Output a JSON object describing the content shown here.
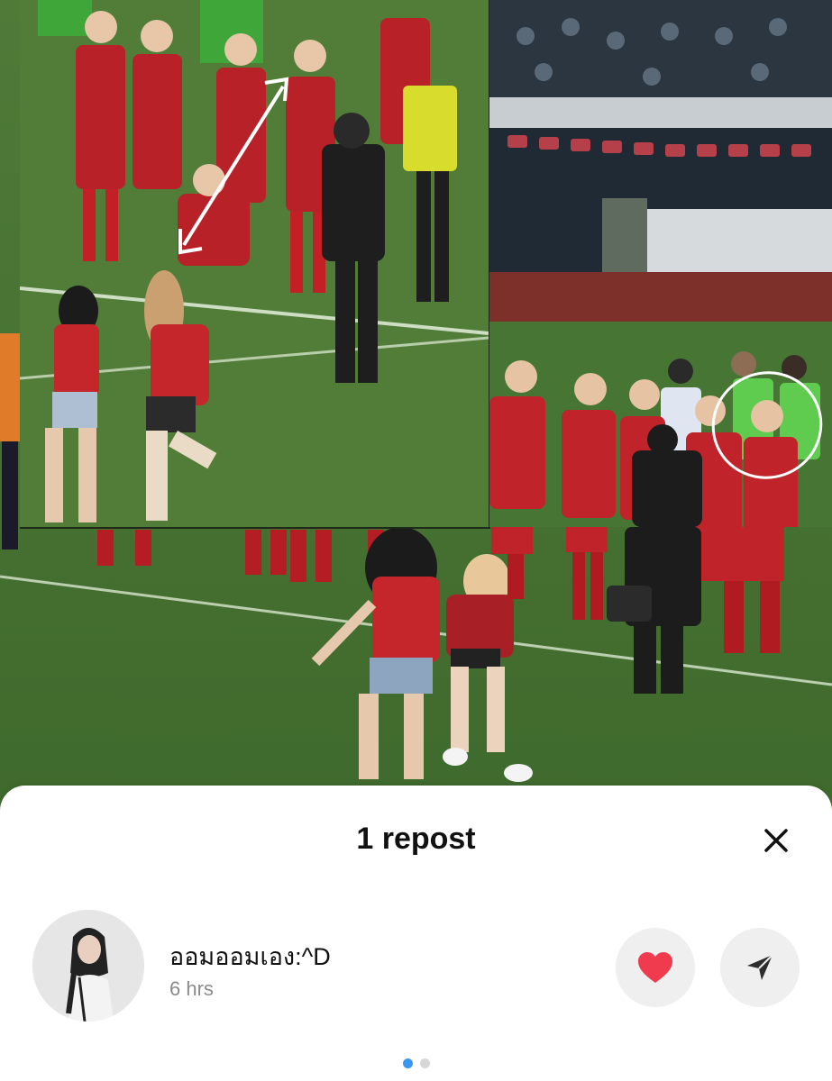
{
  "colors": {
    "accent": "#3897f0",
    "like_heart": "#ef3b4d",
    "button_bg": "#efefef"
  },
  "sheet": {
    "title": "1 repost",
    "close_icon": "close-icon",
    "repost": {
      "username": "ออมออมเอง:^D",
      "time": "6 hrs",
      "like_icon": "heart-icon",
      "share_icon": "send-icon"
    },
    "pagination": {
      "pages": 2,
      "current": 1
    }
  }
}
